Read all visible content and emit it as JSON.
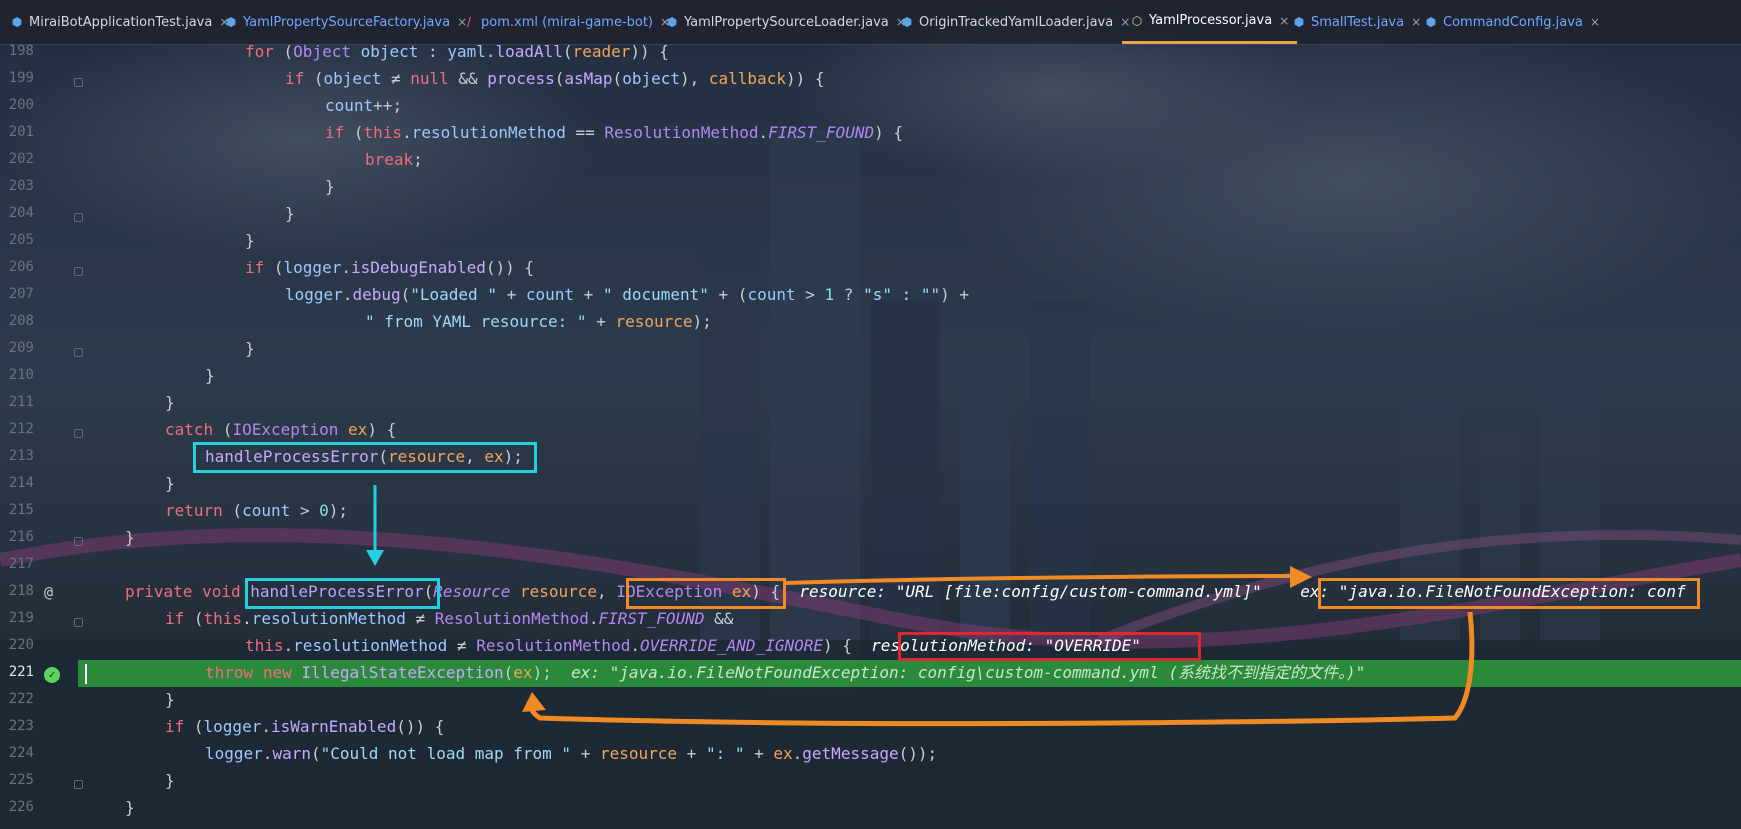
{
  "tabs": [
    {
      "label": "MiraiBotApplicationTest.java",
      "icon": "java-class-icon",
      "color": "default"
    },
    {
      "label": "YamlPropertySourceFactory.java",
      "icon": "java-class-icon",
      "color": "blue"
    },
    {
      "label": "pom.xml (mirai-game-bot)",
      "icon": "maven-icon",
      "color": "blue"
    },
    {
      "label": "YamlPropertySourceLoader.java",
      "icon": "java-class-icon",
      "color": "default"
    },
    {
      "label": "OriginTrackedYamlLoader.java",
      "icon": "java-class-icon",
      "color": "default"
    },
    {
      "label": "YamlProcessor.java",
      "icon": "java-abstract-class-icon",
      "color": "active"
    },
    {
      "label": "SmallTest.java",
      "icon": "java-class-icon",
      "color": "blue"
    },
    {
      "label": "CommandConfig.java",
      "icon": "java-class-icon",
      "color": "blue"
    }
  ],
  "close_glyph": "×",
  "line_numbers": [
    "198",
    "199",
    "200",
    "201",
    "202",
    "203",
    "204",
    "205",
    "206",
    "207",
    "208",
    "209",
    "210",
    "211",
    "212",
    "213",
    "214",
    "215",
    "216",
    "217",
    "218",
    "219",
    "220",
    "221",
    "222",
    "223",
    "224",
    "225",
    "226"
  ],
  "current_line": "221",
  "gutter_marker": "@",
  "debug_hints": {
    "resource": "resource: \"URL [file:config/custom-command.yml]\"",
    "ex": "ex: \"java.io.FileNotFoundException: conf",
    "resolution_method": "resolutionMethod: \"OVERRIDE\"",
    "ex_line221": "ex: \"java.io.FileNotFoundException: config\\custom-command.yml (系统找不到指定的文件。)\""
  },
  "colors": {
    "accent_active_tab": "#e8a34a",
    "highlight_line": "#2ea03c",
    "box_cyan": "#22d0e0",
    "box_orange": "#f08a24",
    "box_red": "#e0282c"
  }
}
